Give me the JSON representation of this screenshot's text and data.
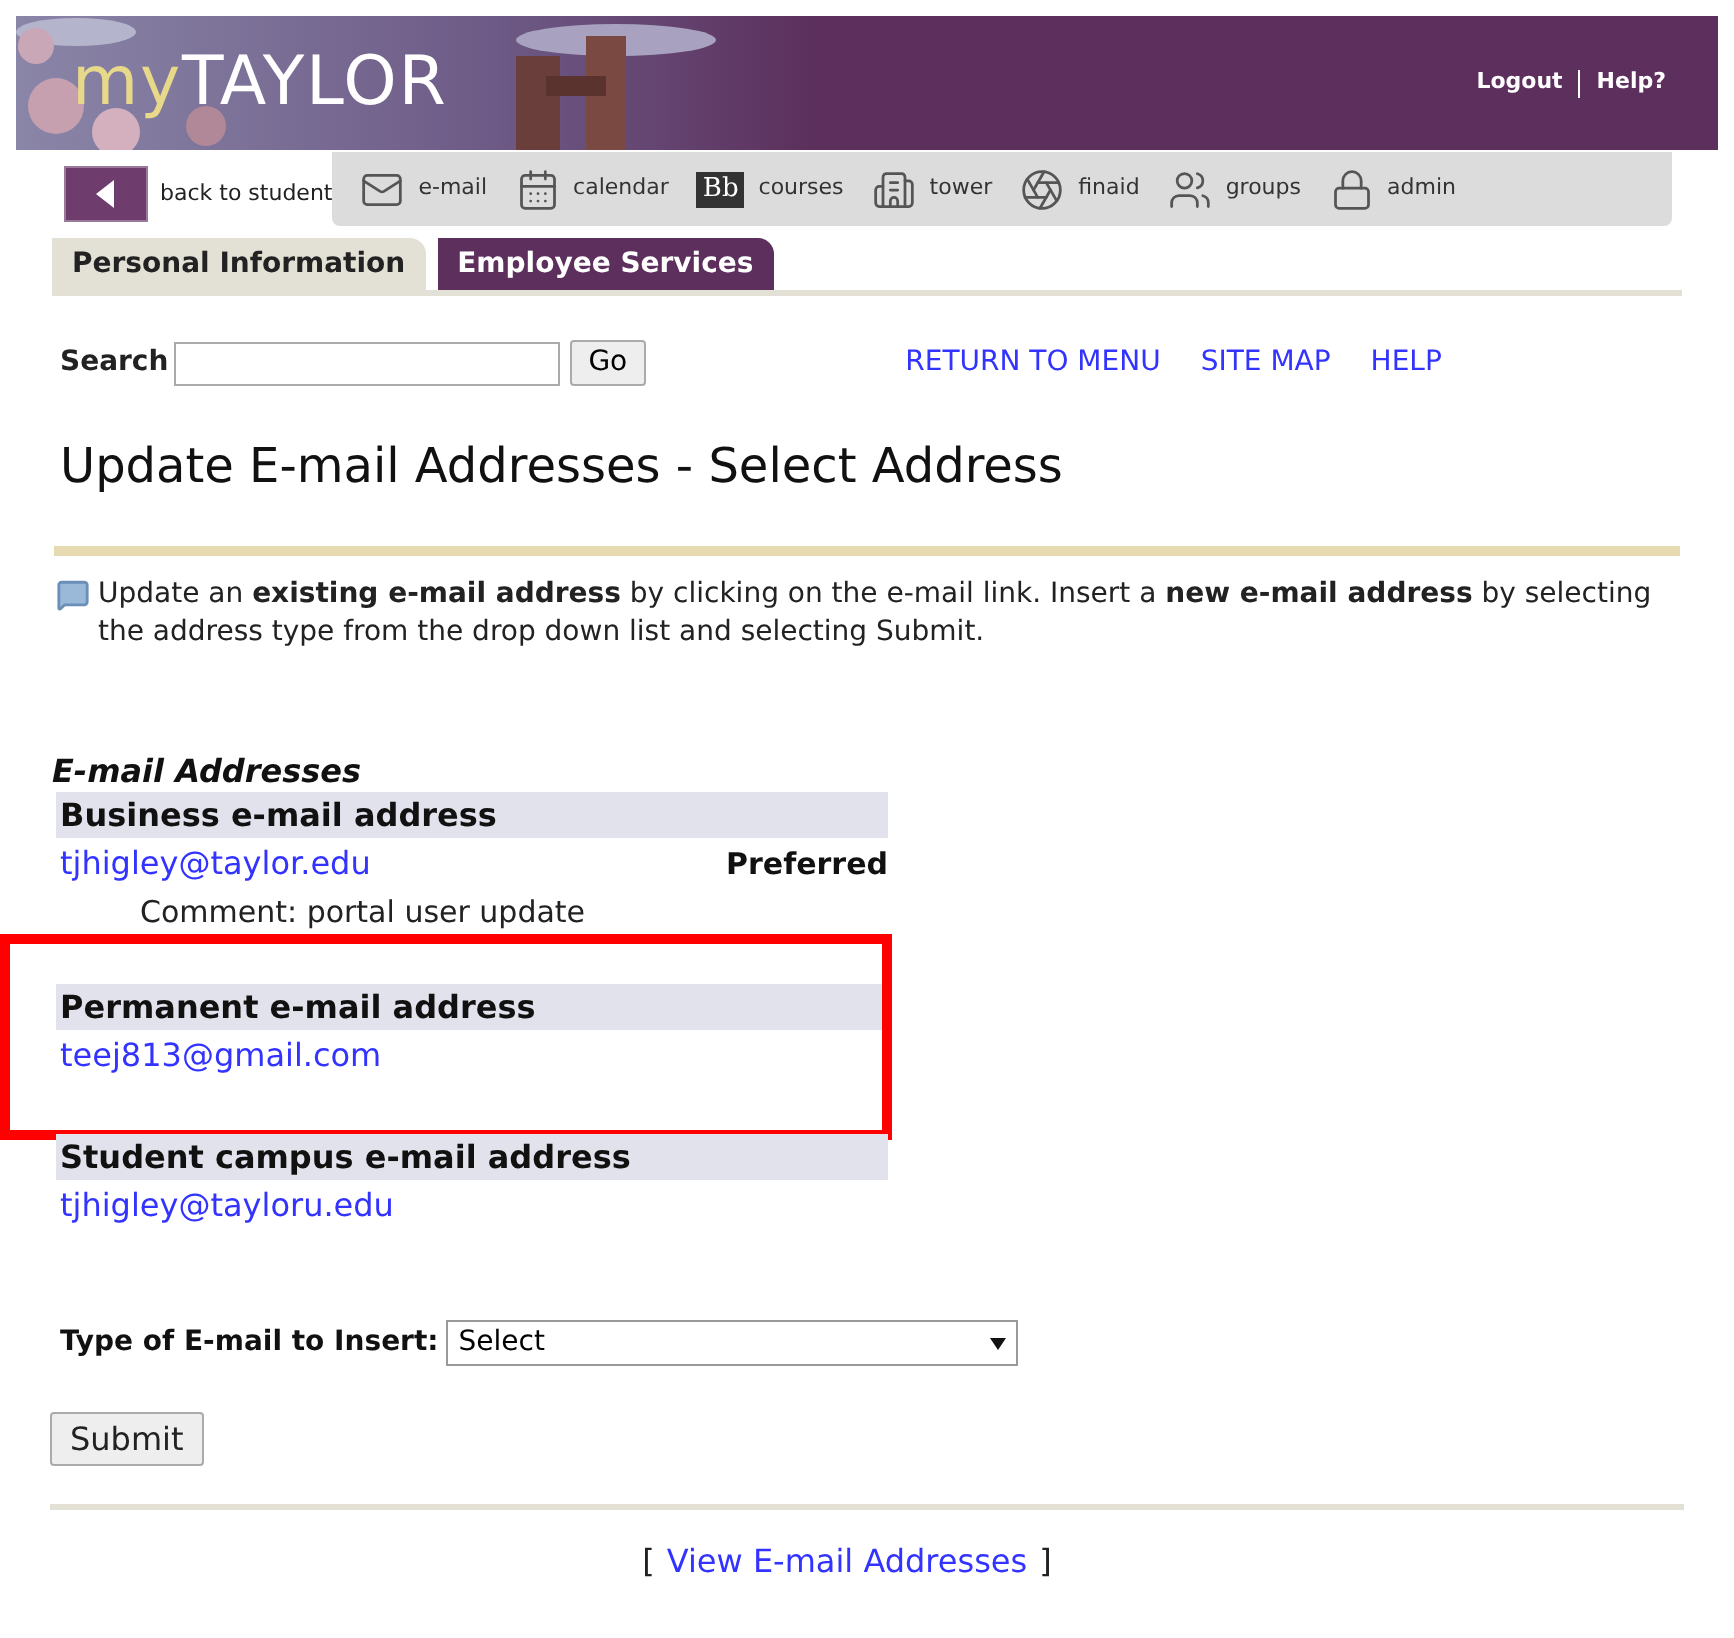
{
  "header": {
    "logo_prefix": "my",
    "logo_main": "TAYLOR",
    "links": [
      "Logout",
      "Help?"
    ]
  },
  "nav": {
    "back": "back to student",
    "items": [
      {
        "label": "e-mail"
      },
      {
        "label": "calendar"
      },
      {
        "label": "courses",
        "badge": "Bb"
      },
      {
        "label": "tower"
      },
      {
        "label": "finaid"
      },
      {
        "label": "groups"
      },
      {
        "label": "admin"
      }
    ]
  },
  "tabs": [
    {
      "label": "Personal Information",
      "selected": false
    },
    {
      "label": "Employee Services",
      "selected": true
    }
  ],
  "search": {
    "label": "Search",
    "button": "Go"
  },
  "top_links": [
    "RETURN TO MENU",
    "SITE MAP",
    "HELP"
  ],
  "title": "Update E-mail Addresses - Select Address",
  "info": "Update an **existing e-mail address** by clicking on the e-mail link. Insert a **new e-mail address** by selecting the address type from the drop down list and selecting Submit.",
  "section_title": "E-mail Addresses",
  "addresses": [
    {
      "type": "Business e-mail address",
      "email": "tjhigley@taylor.edu",
      "flag": "Preferred",
      "comment": "Comment: portal user update",
      "highlighted": false
    },
    {
      "type": "Permanent e-mail address",
      "email": "teej813@gmail.com",
      "highlighted": true
    },
    {
      "type": "Student campus e-mail address",
      "email": "tjhigley@tayloru.edu",
      "highlighted": false
    }
  ],
  "insert": {
    "label": "Type of E-mail to Insert:",
    "value": "Select"
  },
  "submit": "Submit",
  "footer": {
    "open": "[",
    "link": "View E-mail Addresses",
    "close": "]"
  }
}
